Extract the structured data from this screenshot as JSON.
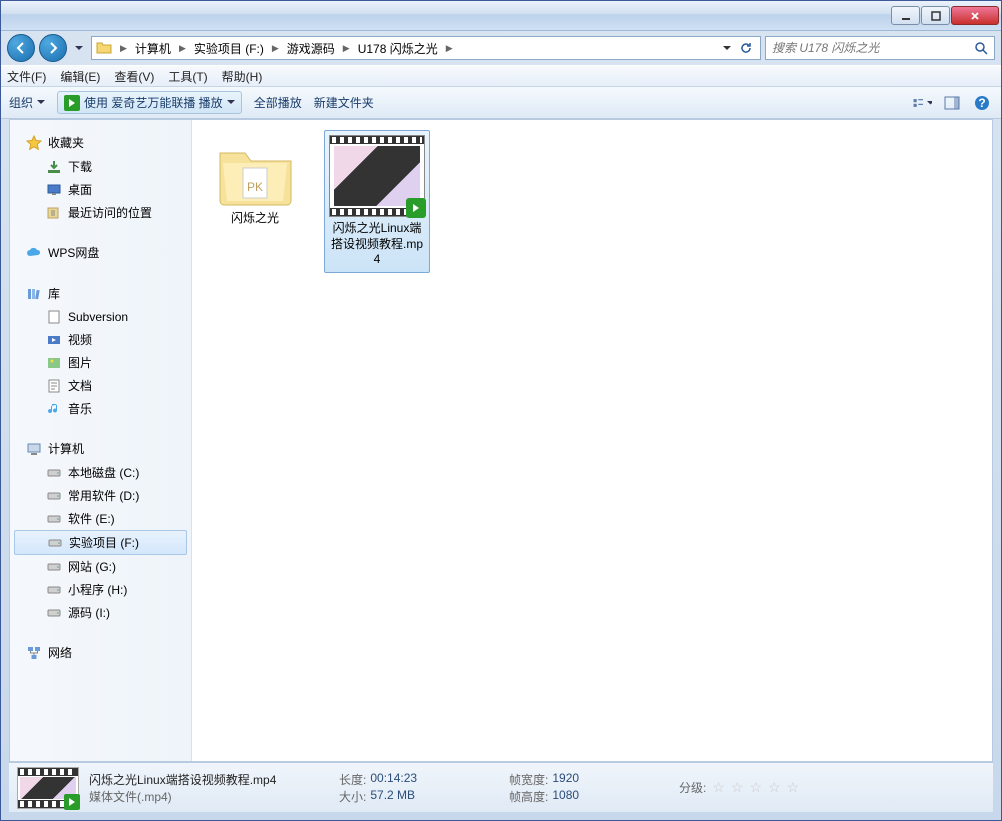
{
  "breadcrumb": {
    "items": [
      "计算机",
      "实验项目 (F:)",
      "游戏源码",
      "U178 闪烁之光"
    ]
  },
  "search": {
    "placeholder": "搜索 U178 闪烁之光"
  },
  "menubar": [
    "文件(F)",
    "编辑(E)",
    "查看(V)",
    "工具(T)",
    "帮助(H)"
  ],
  "toolbar": {
    "organize": "组织",
    "play_label": "使用 爱奇艺万能联播 播放",
    "play_all": "全部播放",
    "new_folder": "新建文件夹"
  },
  "sidebar": {
    "favorites": {
      "label": "收藏夹",
      "items": [
        "下载",
        "桌面",
        "最近访问的位置"
      ]
    },
    "wps": {
      "label": "WPS网盘"
    },
    "libraries": {
      "label": "库",
      "items": [
        "Subversion",
        "视频",
        "图片",
        "文档",
        "音乐"
      ]
    },
    "computer": {
      "label": "计算机",
      "items": [
        "本地磁盘 (C:)",
        "常用软件 (D:)",
        "软件 (E:)",
        "实验项目 (F:)",
        "网站 (G:)",
        "小程序 (H:)",
        "源码 (I:)"
      ],
      "selected": 3
    },
    "network": {
      "label": "网络"
    }
  },
  "files": {
    "folder": {
      "name": "闪烁之光"
    },
    "video": {
      "name": "闪烁之光Linux端搭设视频教程.mp4"
    }
  },
  "status": {
    "filename": "闪烁之光Linux端搭设视频教程.mp4",
    "filetype": "媒体文件(.mp4)",
    "props": {
      "duration_k": "长度:",
      "duration_v": "00:14:23",
      "size_k": "大小:",
      "size_v": "57.2 MB",
      "width_k": "帧宽度:",
      "width_v": "1920",
      "height_k": "帧高度:",
      "height_v": "1080",
      "rating_k": "分级:"
    }
  }
}
